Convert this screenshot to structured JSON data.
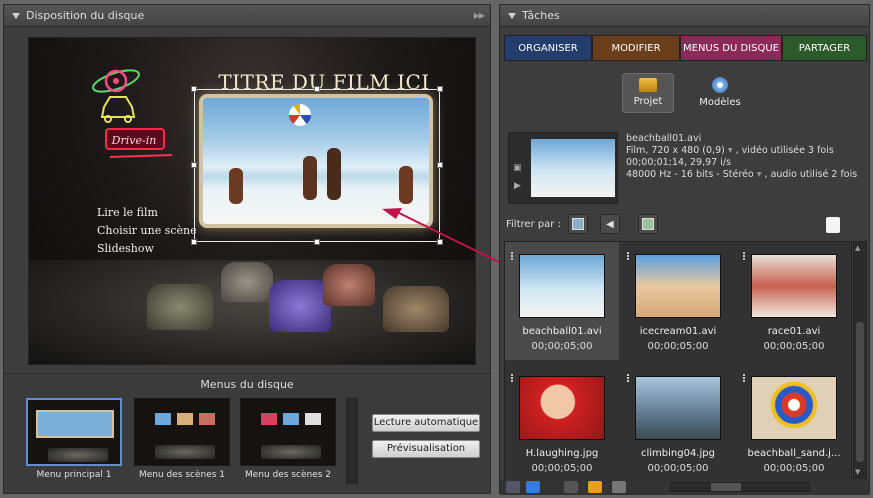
{
  "left_panel": {
    "title": "Disposition du disque"
  },
  "menu_preview": {
    "title": "TITRE DU FILM ICI",
    "items": [
      "Lire le film",
      "Choisir une scène",
      "Slideshow"
    ],
    "neon_sign": "Drive-in"
  },
  "disc_menus": {
    "title": "Menus du disque",
    "thumbs": [
      {
        "label": "Menu principal 1"
      },
      {
        "label": "Menu des scènes 1"
      },
      {
        "label": "Menu des scènes 2"
      }
    ],
    "autoplay_button": "Lecture automatique",
    "preview_button": "Prévisualisation"
  },
  "right_panel": {
    "title": "Tâches"
  },
  "tabs": [
    {
      "label": "ORGANISER",
      "color": "#233d6c"
    },
    {
      "label": "MODIFIER",
      "color": "#6b3f1c"
    },
    {
      "label": "MENUS DU DISQUE",
      "color": "#8a2a58"
    },
    {
      "label": "PARTAGER",
      "color": "#2d5a2a"
    }
  ],
  "project_button": {
    "label": "Projet",
    "icon": "folder-icon"
  },
  "templates_button": {
    "label": "Modèles",
    "icon": "disc-icon"
  },
  "clip_info": {
    "name": "beachball01.avi",
    "line2": "Film, 720 x 480 (0,9)",
    "line2b": ", vidéo utilisée 3 fois",
    "line3": "00;00;01;14, 29,97 i/s",
    "line4": "48000 Hz - 16 bits - Stéréo",
    "line4b": ", audio utilisé 2 fois"
  },
  "filter": {
    "label": "Filtrer par :"
  },
  "media": [
    {
      "name": "beachball01.avi",
      "duration": "00;00;05;00"
    },
    {
      "name": "icecream01.avi",
      "duration": "00;00;05;00"
    },
    {
      "name": "race01.avi",
      "duration": "00;00;05;00"
    },
    {
      "name": "H.laughing.jpg",
      "duration": "00;00;05;00"
    },
    {
      "name": "climbing04.jpg",
      "duration": "00;00;05;00"
    },
    {
      "name": "beachball_sand.j...",
      "duration": "00;00;05;00"
    }
  ]
}
